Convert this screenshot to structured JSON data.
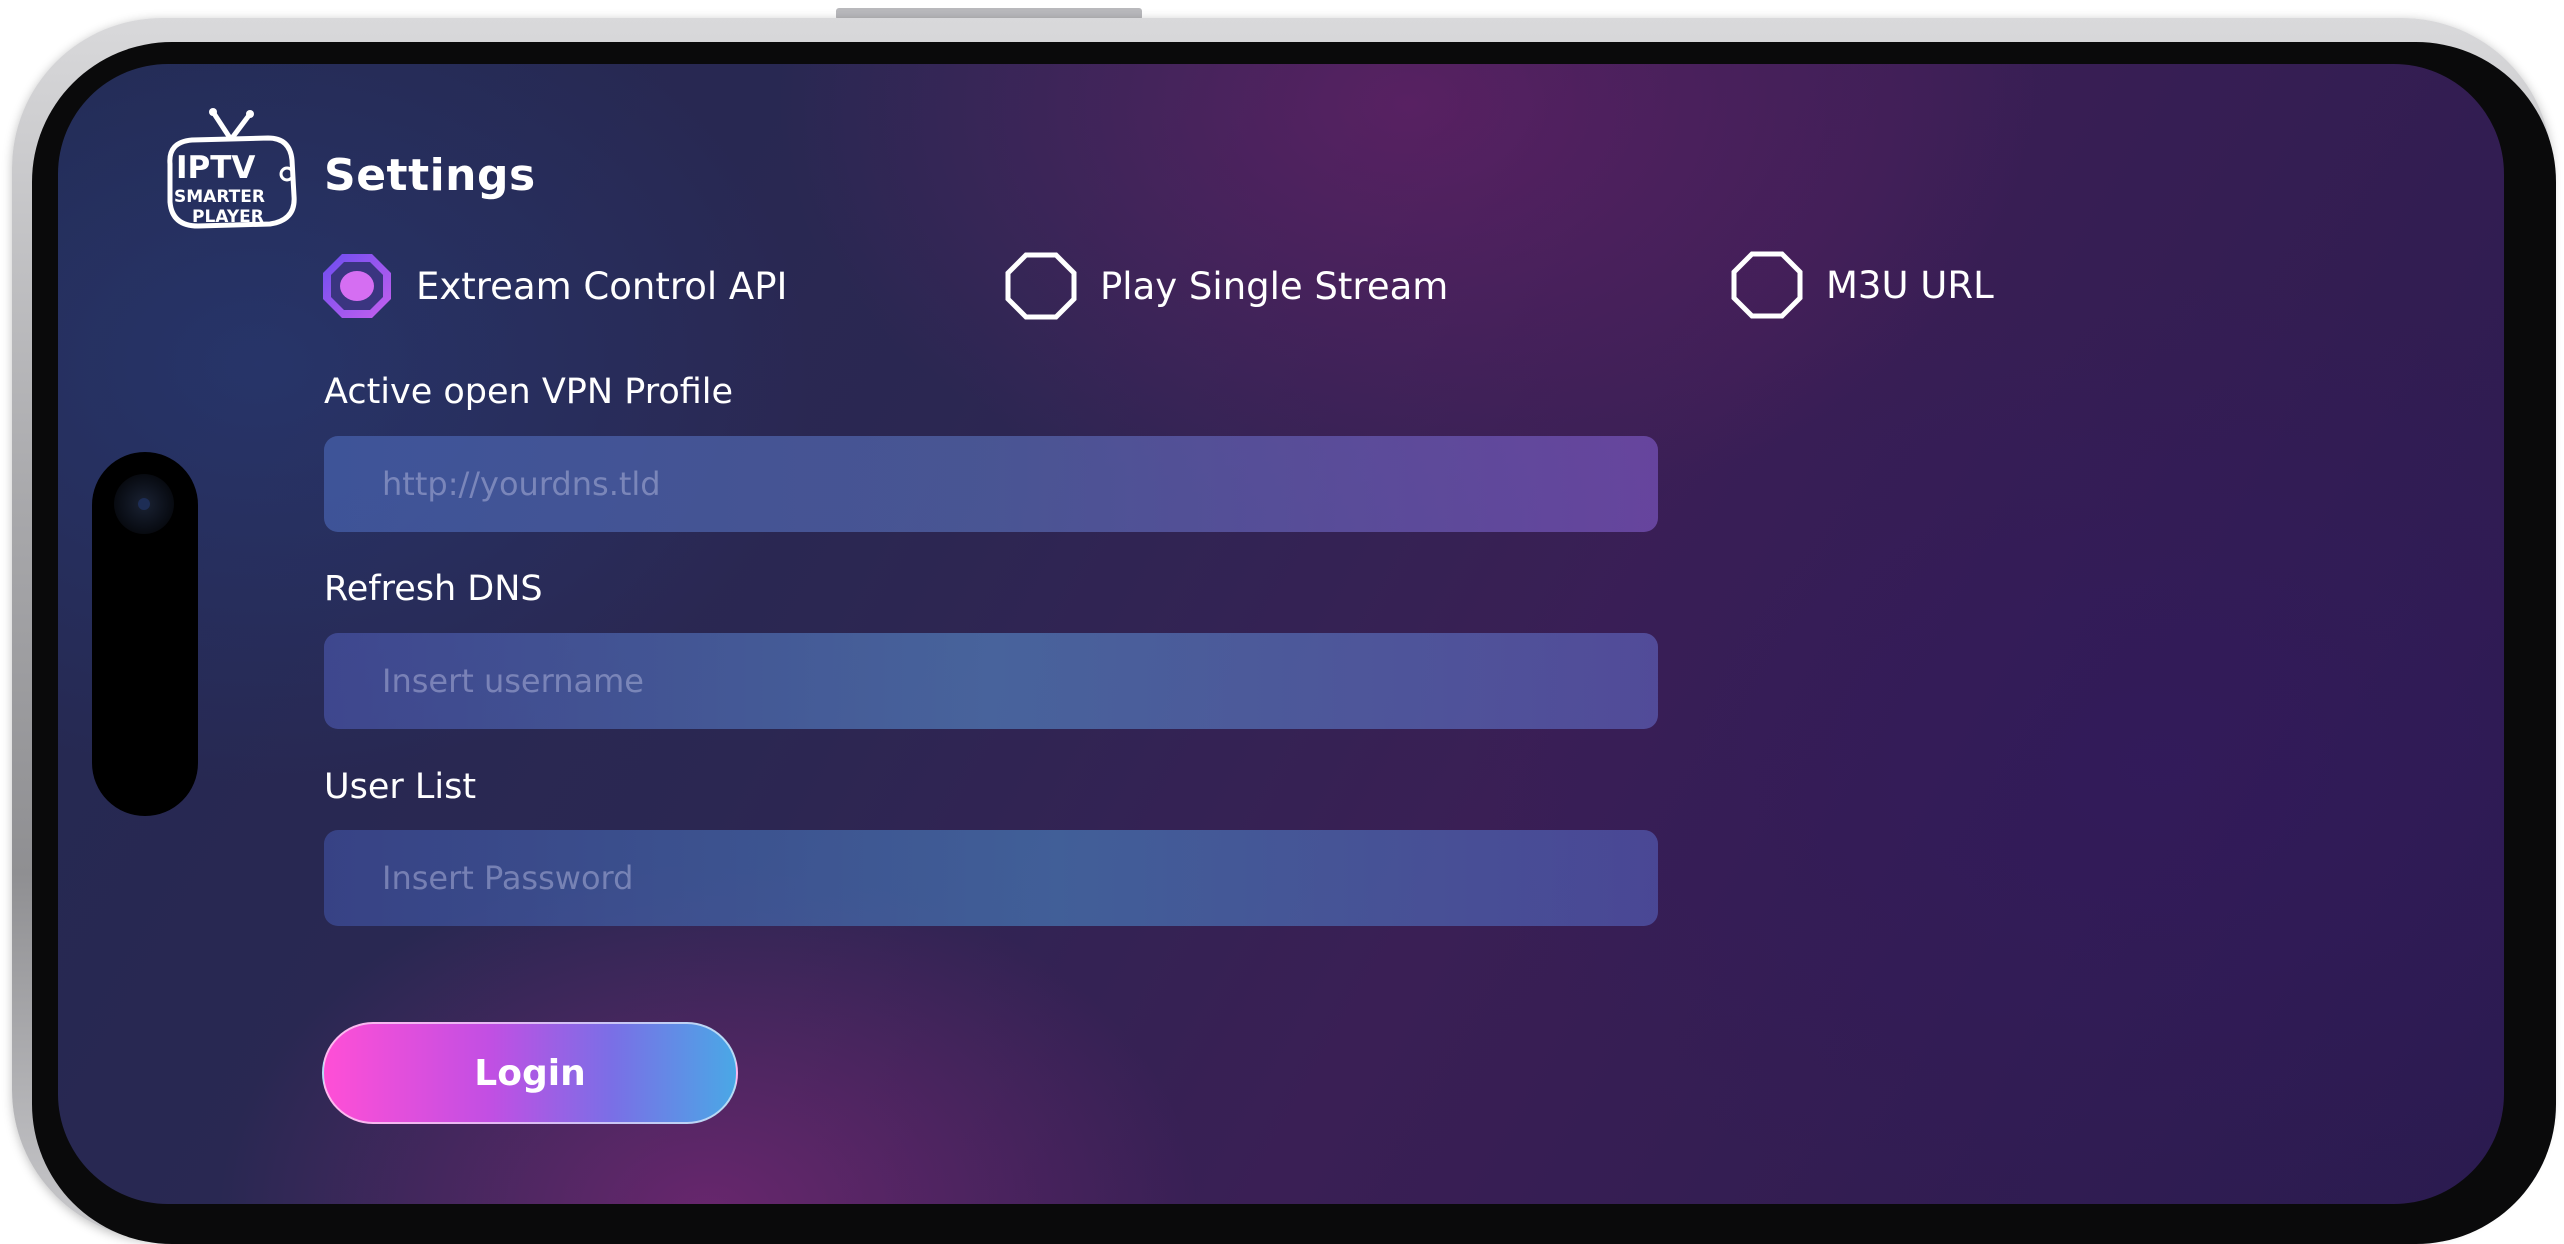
{
  "header": {
    "title": "Settings",
    "logo": {
      "line1": "IPTV",
      "line2": "SMARTER",
      "line3": "PLAYER"
    }
  },
  "login_type": {
    "options": [
      {
        "label": "Extream Control API",
        "selected": true
      },
      {
        "label": "Play Single Stream",
        "selected": false
      },
      {
        "label": "M3U URL",
        "selected": false
      }
    ]
  },
  "form": {
    "fields": [
      {
        "label": "Active open VPN Profile",
        "placeholder": "http://yourdns.tld",
        "value": ""
      },
      {
        "label": "Refresh DNS",
        "placeholder": "Insert username",
        "value": ""
      },
      {
        "label": "User List",
        "placeholder": "Insert Password",
        "value": ""
      }
    ],
    "submit_label": "Login"
  },
  "colors": {
    "accent_pink": "#ff4fd6",
    "accent_blue": "#4aa8e6",
    "radio_selected": "#b15df0",
    "text": "#ffffff"
  },
  "icons": [
    "tv-logo-icon",
    "radio-selected-icon",
    "radio-unselected-icon",
    "camera-icon"
  ]
}
